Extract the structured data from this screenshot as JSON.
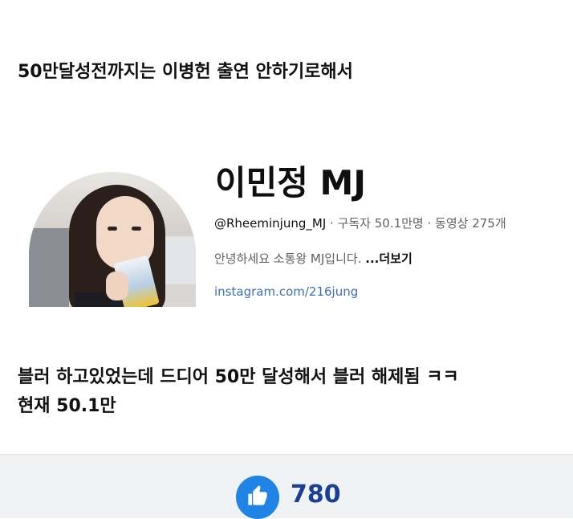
{
  "post": {
    "intro_text": "50만달성전까지는 이병헌 출연 안하기로해서",
    "body_line_1": "블러 하고있었는데 드디어 50만 달성해서 블러 해제됨 ㅋㅋ",
    "body_line_2": "현재 50.1만"
  },
  "channel": {
    "name": "이민정 MJ",
    "handle": "@Rheeminjung_MJ",
    "meta_separator_1": " · ",
    "subscribers": "구독자 50.1만명",
    "meta_separator_2": " · ",
    "videos": "동영상 275개",
    "description": "안녕하세요 소통왕 MJ입니다. ",
    "more_label": "...더보기",
    "link": "instagram.com/216jung",
    "avatar_icon": "channel-avatar-photo"
  },
  "reactions": {
    "like_icon": "thumbs-up-icon",
    "like_count": "780",
    "like_color": "#1f84e6",
    "count_color": "#1a3f93"
  }
}
